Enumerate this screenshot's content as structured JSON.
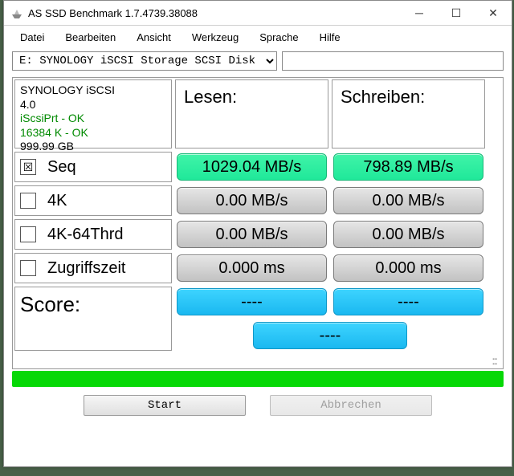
{
  "window": {
    "title": "AS SSD Benchmark 1.7.4739.38088"
  },
  "menu": {
    "items": [
      "Datei",
      "Bearbeiten",
      "Ansicht",
      "Werkzeug",
      "Sprache",
      "Hilfe"
    ]
  },
  "toolbar": {
    "disk_selected": "E: SYNOLOGY iSCSI Storage SCSI Disk",
    "path": ""
  },
  "info": {
    "name": "SYNOLOGY iSCSI",
    "firmware": "4.0",
    "driver": "iScsiPrt - OK",
    "align": "16384 K - OK",
    "size": "999.99 GB"
  },
  "headers": {
    "read": "Lesen:",
    "write": "Schreiben:"
  },
  "rows": {
    "seq": {
      "label": "Seq",
      "checked": true,
      "read": "1029.04 MB/s",
      "write": "798.89 MB/s",
      "style": "green"
    },
    "k4": {
      "label": "4K",
      "checked": false,
      "read": "0.00 MB/s",
      "write": "0.00 MB/s",
      "style": "gray"
    },
    "k4t": {
      "label": "4K-64Thrd",
      "checked": false,
      "read": "0.00 MB/s",
      "write": "0.00 MB/s",
      "style": "gray"
    },
    "acc": {
      "label": "Zugriffszeit",
      "checked": false,
      "read": "0.000 ms",
      "write": "0.000 ms",
      "style": "gray"
    }
  },
  "score": {
    "label": "Score:",
    "read": "----",
    "write": "----",
    "total": "----"
  },
  "buttons": {
    "start": "Start",
    "cancel": "Abbrechen"
  }
}
